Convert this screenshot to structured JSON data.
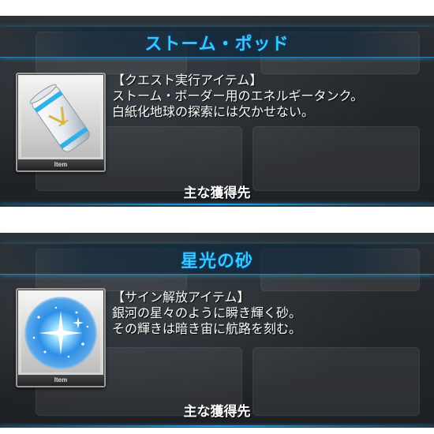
{
  "items": [
    {
      "title": "ストーム・ポッド",
      "description": [
        "【クエスト実行アイテム】",
        "ストーム・ボーダー用のエネルギータンク。",
        "白紙化地球の探索には欠かせない。"
      ],
      "card_label": "Item",
      "acquisition_button": "主な獲得先",
      "icon": "storm-pod-canister-icon"
    },
    {
      "title": "星光の砂",
      "description": [
        "【サイン解放アイテム】",
        "銀河の星々のように瞬き輝く砂。",
        "その輝きは暗き宙に航路を刻む。"
      ],
      "card_label": "Item",
      "acquisition_button": "主な獲得先",
      "icon": "starlight-sand-icon"
    }
  ],
  "colors": {
    "title": "#36c8ff",
    "accent_line": "#2aa3ea",
    "panel_bg": "#23272b"
  }
}
